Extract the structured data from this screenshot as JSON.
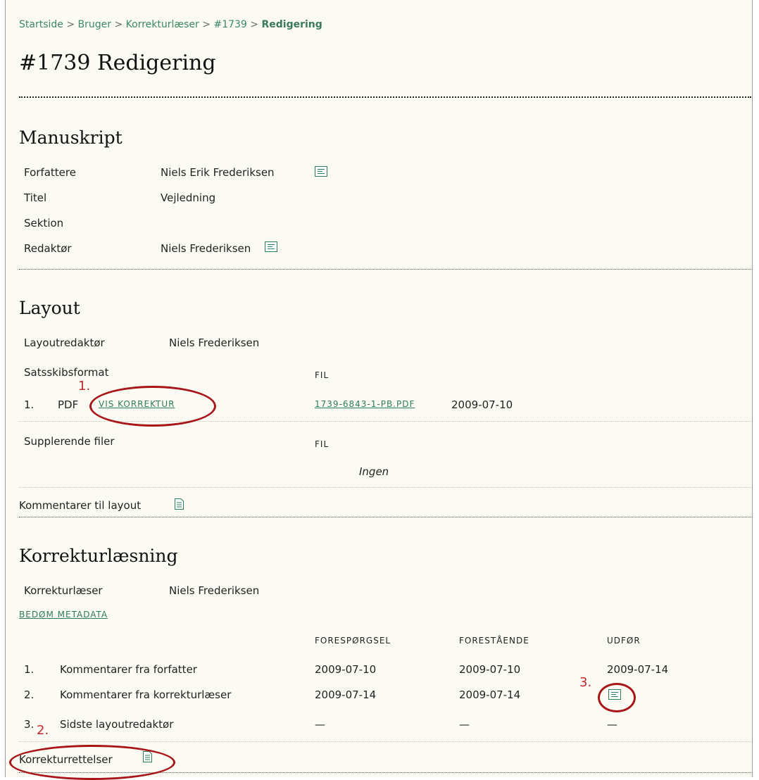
{
  "breadcrumb": {
    "items": [
      "Startside",
      "Bruger",
      "Korrekturlæser",
      "#1739"
    ],
    "current": "Redigering",
    "separator": ">"
  },
  "page_title": "#1739 Redigering",
  "manuscript": {
    "heading": "Manuskript",
    "rows": [
      {
        "label": "Forfattere",
        "value": "Niels Erik Frederiksen",
        "icon": "email-icon"
      },
      {
        "label": "Titel",
        "value": "Vejledning"
      },
      {
        "label": "Sektion",
        "value": ""
      },
      {
        "label": "Redaktør",
        "value": "Niels Frederiksen",
        "icon": "email-icon"
      }
    ]
  },
  "layout": {
    "heading": "Layout",
    "editor_label": "Layoutredaktør",
    "editor_name": "Niels Frederiksen",
    "galley_label": "Satsskibsformat",
    "file_col": "FIL",
    "galley_num": "1.",
    "galley_type": "PDF",
    "view_proof": "VIS KORREKTUR",
    "file_link": "1739-6843-1-PB.PDF",
    "file_date": "2009-07-10",
    "supp_label": "Supplerende filer",
    "supp_file_col": "FIL",
    "supp_none": "Ingen",
    "comments_label": "Kommentarer til layout"
  },
  "proofreading": {
    "heading": "Korrekturlæsning",
    "proofreader_label": "Korrekturlæser",
    "proofreader_name": "Niels Frederiksen",
    "review_metadata": "BEDØM METADATA",
    "columns": [
      "FORESPØRGSEL",
      "FORESTÅENDE",
      "UDFØR"
    ],
    "rows": [
      {
        "num": "1.",
        "label": "Kommentarer fra forfatter",
        "request": "2009-07-10",
        "underway": "2009-07-10",
        "complete": "2009-07-14"
      },
      {
        "num": "2.",
        "label": "Kommentarer fra korrekturlæser",
        "request": "2009-07-14",
        "underway": "2009-07-14",
        "complete_icon": "email-icon"
      },
      {
        "num": "3.",
        "label": "Sidste layoutredaktør",
        "request": "—",
        "underway": "—",
        "complete": "—"
      }
    ],
    "corrections_label": "Korrekturrettelser"
  },
  "annotations": [
    "1.",
    "2.",
    "3."
  ],
  "colors": {
    "background": "#fbfbf3",
    "link": "#2e7d59",
    "annotation": "#c0282c"
  }
}
